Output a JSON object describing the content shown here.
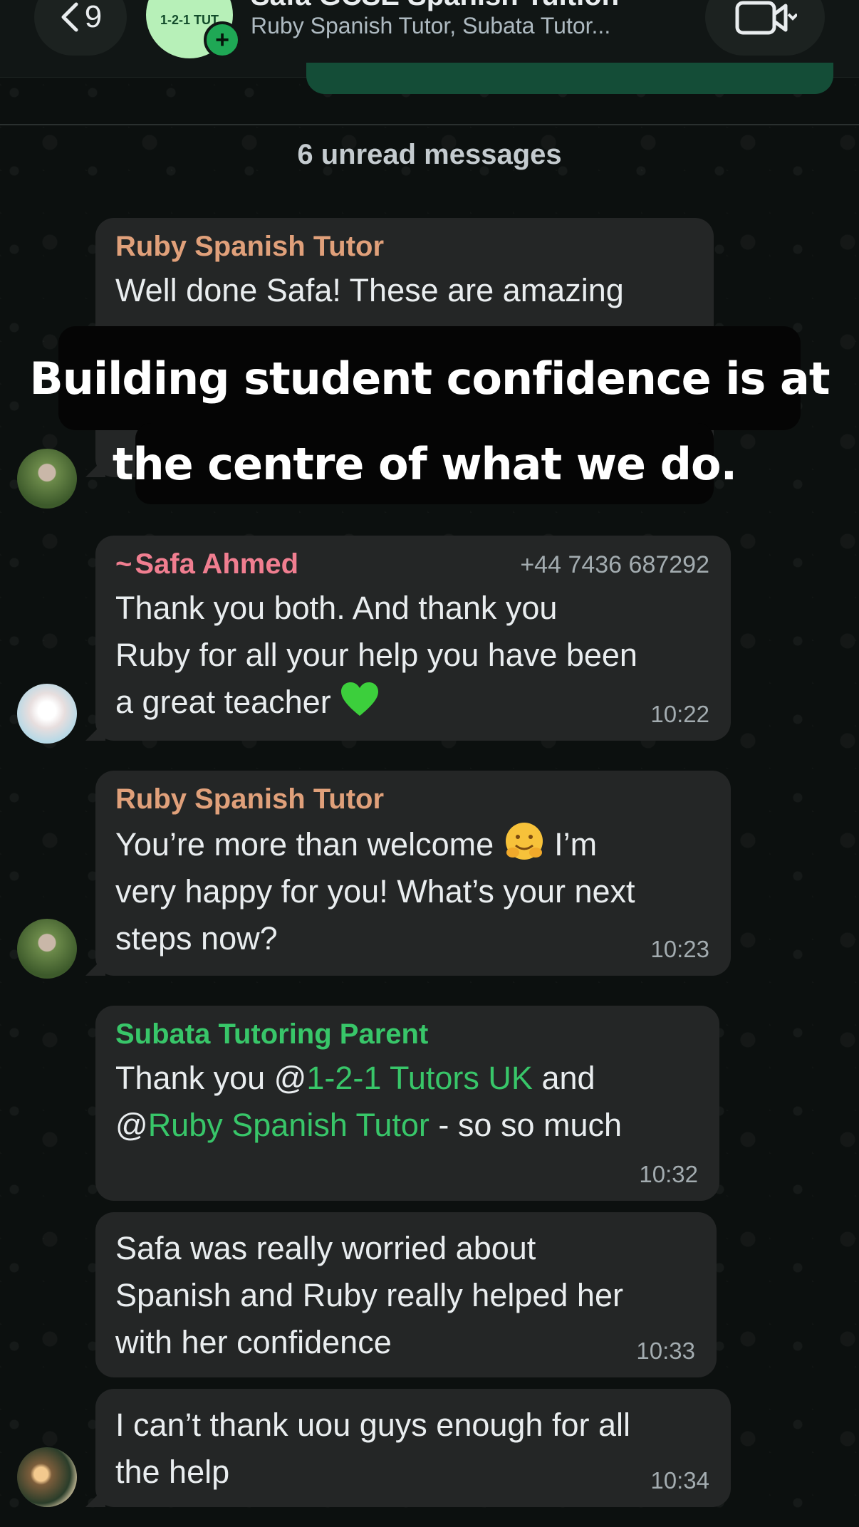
{
  "header": {
    "back_count": "9",
    "group_title": "Safa GCSE Spanish Tuition",
    "members": "Ruby Spanish Tutor, Subata Tutor...",
    "logo_text": "1-2-1 TUT"
  },
  "unread_label": "6 unread messages",
  "caption": {
    "line1": "Building student confidence is at",
    "line2": "the centre of what we do."
  },
  "messages": [
    {
      "sender": "Ruby Spanish Tutor",
      "text": "Well done Safa! These are amazing"
    },
    {
      "sender": "Safa Ahmed",
      "phone": "+44 7436 687292",
      "text_a": "Thank you both. And thank you",
      "text_b": "Ruby for all your help you have been",
      "text_c": "a great teacher",
      "time": "10:22"
    },
    {
      "sender": "Ruby Spanish Tutor",
      "text_a": "You’re more than welcome",
      "text_a2": "I’m",
      "text_b": "very happy for you! What’s your next",
      "text_c": "steps now?",
      "time": "10:23"
    },
    {
      "sender": "Subata Tutoring Parent",
      "pre1": "Thank you @",
      "mention1": "1-2-1 Tutors UK",
      "post1": " and",
      "pre2": "@",
      "mention2": "Ruby Spanish Tutor",
      "post2": " - so so much",
      "time": "10:32"
    },
    {
      "text_a": "Safa was really worried about",
      "text_b": "Spanish and Ruby really helped her",
      "text_c": "with her confidence",
      "time": "10:33"
    },
    {
      "text_a": "I can’t thank uou guys enough for all",
      "text_b": "the help",
      "time": "10:34"
    }
  ],
  "colors": {
    "bubble": "#242626",
    "ruby_name": "#e0a07a",
    "safa_name": "#f07e90",
    "parent_name": "#38c669"
  }
}
